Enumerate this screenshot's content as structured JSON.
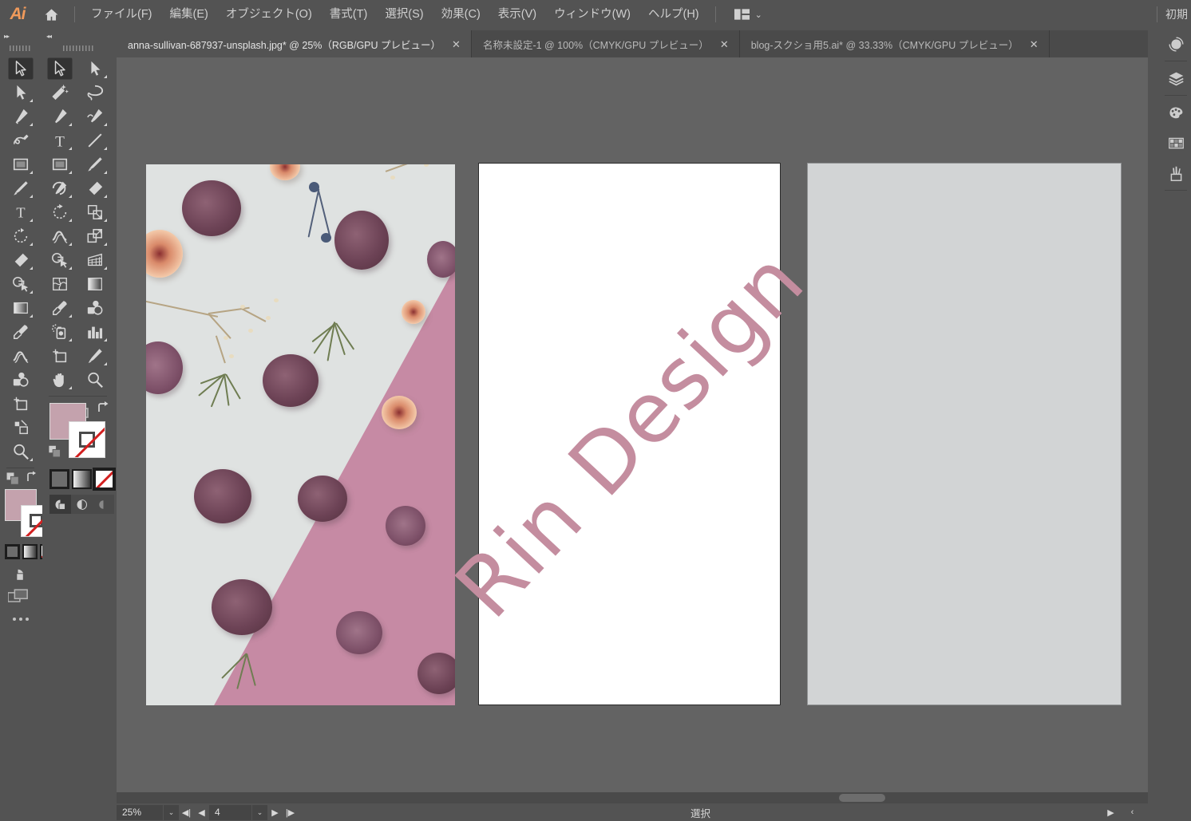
{
  "app": {
    "logo": "Ai",
    "home_icon": "home-icon",
    "workspace_label": "初期"
  },
  "menubar": {
    "items": [
      {
        "label": "ファイル(F)"
      },
      {
        "label": "編集(E)"
      },
      {
        "label": "オブジェクト(O)"
      },
      {
        "label": "書式(T)"
      },
      {
        "label": "選択(S)"
      },
      {
        "label": "効果(C)"
      },
      {
        "label": "表示(V)"
      },
      {
        "label": "ウィンドウ(W)"
      },
      {
        "label": "ヘルプ(H)"
      }
    ],
    "workspace_switcher_icon": "workspace-layout-icon",
    "workspace_chevron": "⌄"
  },
  "tabs": [
    {
      "label": "anna-sullivan-687937-unsplash.jpg* @ 25%（RGB/GPU プレビュー）",
      "active": true,
      "close": "✕"
    },
    {
      "label": "名称未設定-1 @ 100%（CMYK/GPU プレビュー）",
      "active": false,
      "close": "✕"
    },
    {
      "label": "blog-スクショ用5.ai* @ 33.33%（CMYK/GPU プレビュー）",
      "active": false,
      "close": "✕"
    }
  ],
  "toolbar_narrow": {
    "collapse_icon": "expand-right-icon",
    "tools": [
      {
        "name": "selection-tool",
        "selected": true,
        "flyout": false
      },
      {
        "name": "direct-selection-tool",
        "selected": false,
        "flyout": true
      },
      {
        "name": "pen-tool",
        "selected": false,
        "flyout": true
      },
      {
        "name": "curvature-tool",
        "selected": false,
        "flyout": false
      },
      {
        "name": "rectangle-tool",
        "selected": false,
        "flyout": true
      },
      {
        "name": "paintbrush-tool",
        "selected": false,
        "flyout": true
      },
      {
        "name": "type-tool",
        "selected": false,
        "flyout": true
      },
      {
        "name": "rotate-tool",
        "selected": false,
        "flyout": true
      },
      {
        "name": "eraser-tool",
        "selected": false,
        "flyout": true
      },
      {
        "name": "shape-builder-tool",
        "selected": false,
        "flyout": true
      },
      {
        "name": "gradient-tool",
        "selected": false,
        "flyout": true
      },
      {
        "name": "eyedropper-tool",
        "selected": false,
        "flyout": false
      },
      {
        "name": "width-tool",
        "selected": false,
        "flyout": false
      },
      {
        "name": "blend-tool",
        "selected": false,
        "flyout": false
      },
      {
        "name": "artboard-tool",
        "selected": false,
        "flyout": false
      },
      {
        "name": "slice-tool",
        "selected": false,
        "flyout": false
      },
      {
        "name": "zoom-tool",
        "selected": false,
        "flyout": true
      }
    ],
    "more_tools": "edit-toolbar-dots"
  },
  "toolbar_wide": {
    "collapse_icon": "collapse-left-icon",
    "tools": [
      {
        "name": "selection-tool",
        "selected": true,
        "flyout": false
      },
      {
        "name": "direct-selection-tool",
        "selected": false,
        "flyout": true
      },
      {
        "name": "magic-wand-tool",
        "selected": false,
        "flyout": false
      },
      {
        "name": "lasso-tool",
        "selected": false,
        "flyout": false
      },
      {
        "name": "pen-tool",
        "selected": false,
        "flyout": true
      },
      {
        "name": "add-anchor-point-tool",
        "selected": false,
        "flyout": true
      },
      {
        "name": "type-tool",
        "selected": false,
        "flyout": true
      },
      {
        "name": "line-segment-tool",
        "selected": false,
        "flyout": true
      },
      {
        "name": "rectangle-tool",
        "selected": false,
        "flyout": true
      },
      {
        "name": "paintbrush-tool",
        "selected": false,
        "flyout": true
      },
      {
        "name": "shaper-tool",
        "selected": false,
        "flyout": true
      },
      {
        "name": "eraser-tool",
        "selected": false,
        "flyout": true
      },
      {
        "name": "rotate-tool",
        "selected": false,
        "flyout": true
      },
      {
        "name": "scale-tool",
        "selected": false,
        "flyout": true
      },
      {
        "name": "width-tool",
        "selected": false,
        "flyout": true
      },
      {
        "name": "free-transform-tool",
        "selected": false,
        "flyout": true
      },
      {
        "name": "shape-builder-tool",
        "selected": false,
        "flyout": true
      },
      {
        "name": "perspective-grid-tool",
        "selected": false,
        "flyout": true
      },
      {
        "name": "mesh-tool",
        "selected": false,
        "flyout": false
      },
      {
        "name": "gradient-tool",
        "selected": false,
        "flyout": false
      },
      {
        "name": "eyedropper-tool",
        "selected": false,
        "flyout": true
      },
      {
        "name": "blend-tool",
        "selected": false,
        "flyout": false
      },
      {
        "name": "symbol-sprayer-tool",
        "selected": false,
        "flyout": true
      },
      {
        "name": "column-graph-tool",
        "selected": false,
        "flyout": true
      },
      {
        "name": "artboard-tool",
        "selected": false,
        "flyout": false
      },
      {
        "name": "slice-tool",
        "selected": false,
        "flyout": true
      },
      {
        "name": "hand-tool",
        "selected": false,
        "flyout": true
      },
      {
        "name": "zoom-tool",
        "selected": false,
        "flyout": false
      }
    ],
    "more_tools": "edit-toolbar-dots"
  },
  "color_controls": {
    "fill_color": "#c4a2ad",
    "stroke_color": "#ffffff",
    "stroke_is_none": true,
    "fill_label": "fill-swatch",
    "stroke_label": "stroke-swatch",
    "swap_label": "swap-fill-stroke",
    "default_label": "default-fill-stroke",
    "modes": [
      {
        "name": "color-mode",
        "selected": false
      },
      {
        "name": "gradient-mode",
        "selected": false
      },
      {
        "name": "none-mode",
        "selected": true
      }
    ],
    "draw_modes": [
      {
        "name": "draw-normal",
        "selected": true
      },
      {
        "name": "draw-behind",
        "selected": false
      },
      {
        "name": "draw-inside",
        "selected": false
      }
    ],
    "screen_mode": "change-screen-mode"
  },
  "canvas": {
    "background_color": "#636363",
    "artboards": [
      {
        "name": "artboard-photo",
        "type": "image",
        "description": "pressed dried flowers flat lay on grey and pink paper"
      },
      {
        "name": "artboard-logo",
        "type": "artwork",
        "background": "#ffffff",
        "text": "Rin Design",
        "text_color": "#c48d9f",
        "rotation_deg": -47,
        "active": true
      },
      {
        "name": "artboard-blank",
        "type": "blank",
        "background": "#d2d4d5"
      }
    ]
  },
  "right_dock": {
    "items": [
      {
        "name": "properties-icon"
      },
      {
        "name": "layers-icon"
      },
      {
        "name": "swatches-icon"
      },
      {
        "name": "color-guide-icon"
      },
      {
        "name": "brushes-icon"
      }
    ]
  },
  "scrollbars": {
    "vertical": {
      "name": "vertical-scrollbar",
      "up_arrow": "⌃"
    },
    "horizontal": {
      "name": "horizontal-scrollbar"
    }
  },
  "statusbar": {
    "zoom_level": "25%",
    "zoom_dropdown": "⌄",
    "nav_first": "◀|",
    "nav_prev": "◀",
    "artboard_number": "4",
    "artboard_dropdown": "⌄",
    "nav_next": "▶",
    "nav_last": "|▶",
    "status_text": "選択",
    "right_arrow": "▶",
    "right_chevron": "‹"
  }
}
